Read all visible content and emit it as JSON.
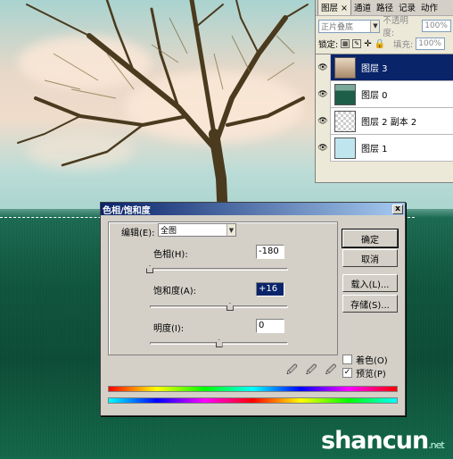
{
  "layers_panel": {
    "tabs": [
      "图层 ×",
      "通道",
      "路径",
      "记录",
      "动作"
    ],
    "blend_mode": "正片叠底",
    "opacity_label": "不透明度:",
    "opacity_value": "100%",
    "lock_label": "锁定:",
    "fill_label": "填充:",
    "fill_value": "100%",
    "layers": [
      {
        "name": "图层 3",
        "selected": true,
        "thumb": "tree"
      },
      {
        "name": "图层 0",
        "selected": false,
        "thumb": "green"
      },
      {
        "name": "图层 2 副本 2",
        "selected": false,
        "thumb": "checker"
      },
      {
        "name": "图层 1",
        "selected": false,
        "thumb": "lightblue"
      }
    ]
  },
  "dialog": {
    "title": "色相/饱和度",
    "close": "x",
    "edit_label": "编辑(E):",
    "edit_value": "全图",
    "hue_label": "色相(H):",
    "hue_value": "-180",
    "saturation_label": "饱和度(A):",
    "saturation_value": "+16",
    "lightness_label": "明度(I):",
    "lightness_value": "0",
    "buttons": {
      "ok": "确定",
      "cancel": "取消",
      "load": "载入(L)...",
      "save": "存储(S)..."
    },
    "colorize_label": "着色(O)",
    "colorize_checked": false,
    "preview_label": "预览(P)",
    "preview_checked": true,
    "slider_levels": {
      "hue": -180,
      "saturation": 16,
      "lightness": 0
    }
  },
  "watermark": {
    "main": "shancun",
    "sub": ".net"
  },
  "colors": {
    "selection": "#0a246a",
    "dialog_bg": "#d4d0c8",
    "grass": "#11573f"
  }
}
